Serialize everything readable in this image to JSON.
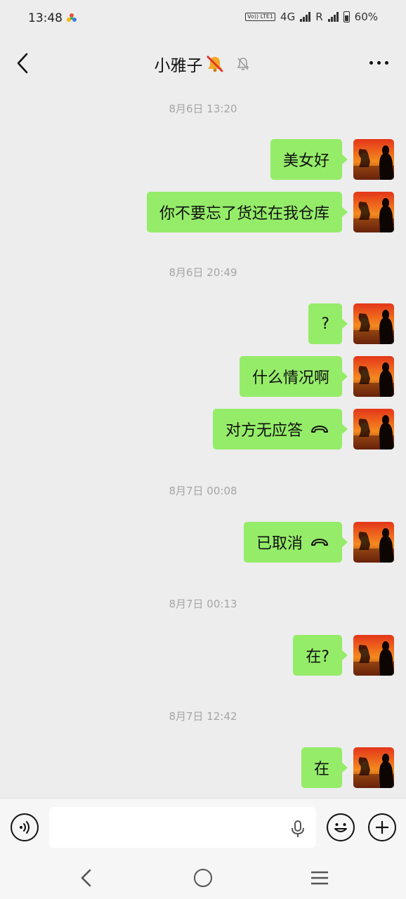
{
  "status_bar": {
    "time": "13:48",
    "volte": "Vo)) LTE1",
    "network": "4G",
    "roaming": "R",
    "battery": "60%"
  },
  "header": {
    "title": "小雅子",
    "back_icon": "chevron-left-icon",
    "mute_icon": "bell-off-icon",
    "more_icon": "more-dots-icon"
  },
  "messages": {
    "t1": "8月6日 13:20",
    "m1": "美女好",
    "m2": "你不要忘了货还在我仓库",
    "t2": "8月6日 20:49",
    "m3": "?",
    "m4": "什么情况啊",
    "m5": "对方无应答",
    "t3": "8月7日 00:08",
    "m6": "已取消",
    "t4": "8月7日 00:13",
    "m7": "在?",
    "t5": "8月7日 12:42",
    "m8": "在"
  },
  "input_bar": {
    "placeholder": "",
    "voice_icon": "voice-icon",
    "mic_icon": "microphone-icon",
    "emoji_icon": "emoji-icon",
    "plus_icon": "plus-icon"
  },
  "colors": {
    "background": "#ededed",
    "bubble_outgoing": "#95ec69",
    "timestamp": "#a5a5a5"
  }
}
